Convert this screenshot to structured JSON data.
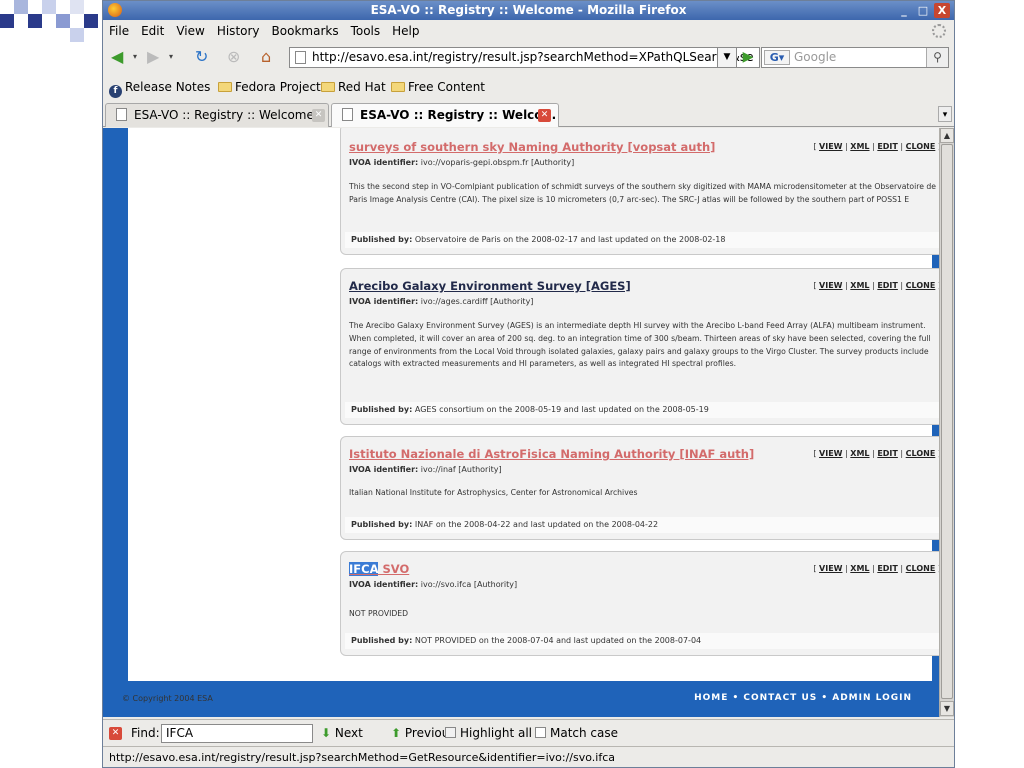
{
  "window": {
    "title": "ESA-VO :: Registry :: Welcome - Mozilla Firefox",
    "minimize": "_",
    "maximize": "□",
    "close": "X"
  },
  "menu": [
    "File",
    "Edit",
    "View",
    "History",
    "Bookmarks",
    "Tools",
    "Help"
  ],
  "nav": {
    "url": "http://esavo.esa.int/registry/result.jsp?searchMethod=XPathQLSearch&se",
    "search_placeholder": "Google",
    "search_engine": "G"
  },
  "bookmarks": [
    "Release Notes",
    "Fedora Project",
    "Red Hat",
    "Free Content"
  ],
  "tabs": [
    {
      "label": "ESA-VO :: Registry :: Welcome",
      "active": false
    },
    {
      "label": "ESA-VO :: Registry :: Welco...",
      "active": true
    }
  ],
  "records": [
    {
      "title": "surveys of southern sky Naming Authority [vopsat auth]",
      "identifier_label": "IVOA identifier:",
      "identifier": "ivo://voparis-gepi.obspm.fr [Authority]",
      "description": "This the second step in VO-Comlpiant publication of schmidt surveys of the southern sky digitized with MAMA microdensitometer at the Observatoire de Paris Image Analysis Centre (CAI). The pixel size is 10 micrometers (0,7 arc-sec). The SRC-J atlas will be followed by the southern part of POSS1 E",
      "published_label": "Published by:",
      "published": "Observatoire de Paris on the 2008-02-17 and last updated on the 2008-02-18"
    },
    {
      "title": "Arecibo Galaxy Environment Survey [AGES]",
      "identifier_label": "IVOA identifier:",
      "identifier": "ivo://ages.cardiff [Authority]",
      "description": "The Arecibo Galaxy Environment Survey (AGES) is an intermediate depth HI survey with the Arecibo L-band Feed Array (ALFA) multibeam instrument. When completed, it will cover an area of 200 sq. deg. to an integration time of 300 s/beam. Thirteen areas of sky have been selected, covering the full range of environments from the Local Void through isolated galaxies, galaxy pairs and galaxy groups to the Virgo Cluster. The survey products include catalogs with extracted measurements and HI parameters, as well as integrated HI spectral profiles.",
      "published_label": "Published by:",
      "published": "AGES consortium on the 2008-05-19 and last updated on the 2008-05-19"
    },
    {
      "title": "Istituto Nazionale di AstroFisica Naming Authority [INAF auth]",
      "identifier_label": "IVOA identifier:",
      "identifier": "ivo://inaf [Authority]",
      "description": "Italian National Institute for Astrophysics, Center for Astronomical Archives",
      "published_label": "Published by:",
      "published": "INAF on the 2008-04-22 and last updated on the 2008-04-22"
    },
    {
      "title_highlight": "IFCA",
      "title_rest": " SVO",
      "identifier_label": "IVOA identifier:",
      "identifier": "ivo://svo.ifca [Authority]",
      "description": "NOT PROVIDED",
      "published_label": "Published by:",
      "published": "NOT PROVIDED on the 2008-07-04 and last updated on the 2008-07-04"
    }
  ],
  "actions": {
    "view": "VIEW",
    "xml": "XML",
    "edit": "EDIT",
    "clone": "CLONE",
    "open": "[",
    "close": "]",
    "sep": "|"
  },
  "footer": {
    "copyright": "© Copyright 2004 ESA",
    "links": "HOME • CONTACT US • ADMIN LOGIN"
  },
  "findbar": {
    "label": "Find:",
    "value": "IFCA",
    "next": "Next",
    "previous": "Previous",
    "highlight": "Highlight all",
    "match_case": "Match case"
  },
  "status": "http://esavo.esa.int/registry/result.jsp?searchMethod=GetResource&identifier=ivo://svo.ifca"
}
